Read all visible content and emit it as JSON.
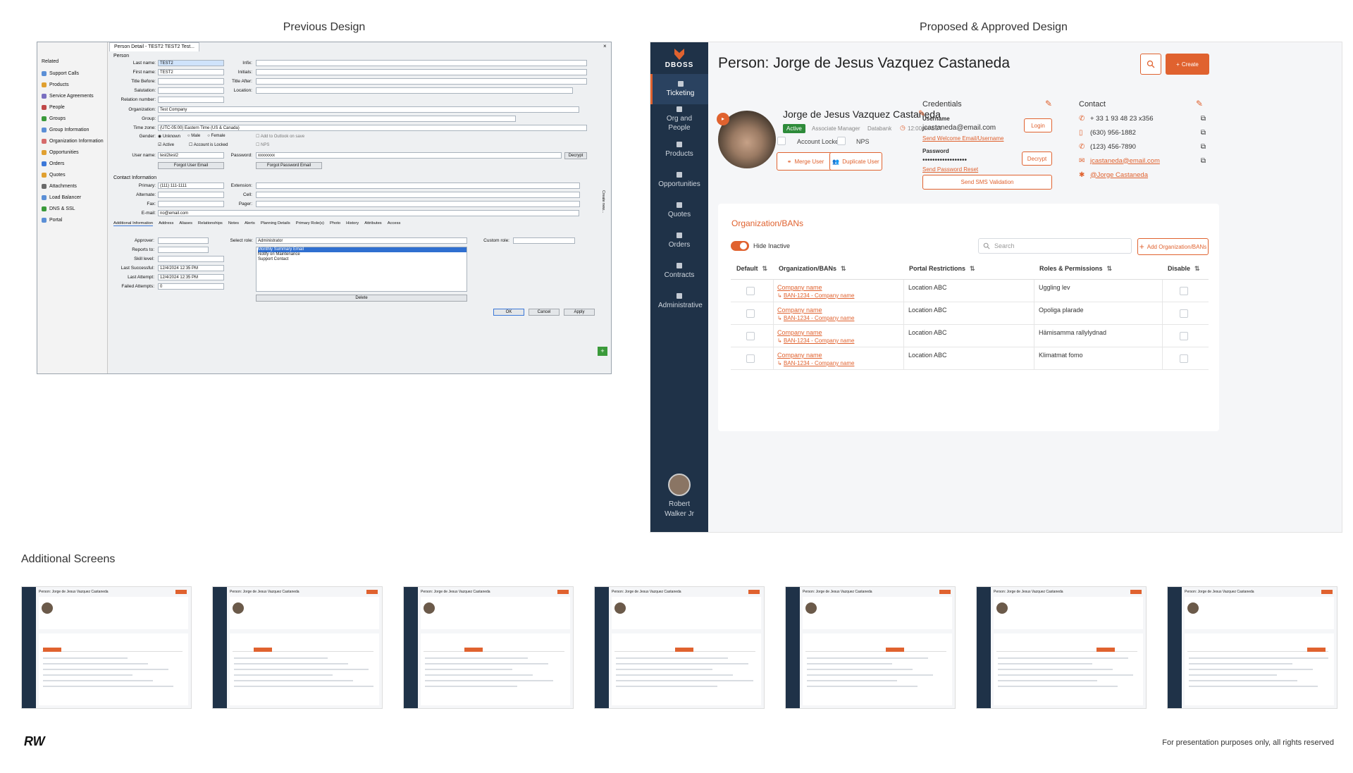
{
  "headings": {
    "previous": "Previous Design",
    "proposed": "Proposed & Approved Design",
    "additional": "Additional Screens",
    "footer_note": "For presentation purposes only, all rights reserved",
    "logo_mark": "RW"
  },
  "old": {
    "tab_title": "Person Detail - TEST2 TEST2   Test...",
    "related_label": "Related",
    "sidebar": [
      "Support Calls",
      "Products",
      "Service Agreements",
      "People",
      "Groups",
      "Group Information",
      "Organization Information",
      "Opportunities",
      "Orders",
      "Quotes",
      "Attachments",
      "Load Balancer",
      "DNS & SSL",
      "Portal"
    ],
    "person_label": "Person",
    "labels": {
      "last_name": "Last name:",
      "first_name": "First name:",
      "title_before": "Title Before:",
      "salutation": "Salutation:",
      "relation_number": "Relation number:",
      "organization": "Organization:",
      "group": "Group:",
      "timezone": "Time zone:",
      "gender": "Gender:",
      "user_name": "User name:",
      "password": "Password:",
      "infix": "Infix:",
      "initials": "Initials:",
      "title_after": "Title After:",
      "location": "Location:"
    },
    "values": {
      "last_name": "TEST2",
      "first_name": "TEST2",
      "organization": "Test Company",
      "timezone": "(UTC-05:00) Eastern Time (US & Canada)",
      "user_name": "test2test2",
      "password": "xxxxxxxx"
    },
    "gender_options": [
      "Unknown",
      "Male",
      "Female"
    ],
    "checks": {
      "active": "Active",
      "locked": "Account is Locked",
      "outlook": "Add to Outlook on save",
      "nps": "NPS"
    },
    "buttons": {
      "forgot_user": "Forgot User Email",
      "forgot_pw": "Forgot Password Email",
      "decrypt": "Decrypt",
      "delete": "Delete",
      "ok": "OK",
      "cancel": "Cancel",
      "apply": "Apply"
    },
    "contact_label": "Contact Information",
    "contact_labels": {
      "primary": "Primary:",
      "alternate": "Alternate:",
      "fax": "Fax:",
      "email": "E-mail:",
      "extension": "Extension:",
      "cell": "Cell:",
      "pager": "Pager:"
    },
    "contact_values": {
      "primary": "(111) 111-1111",
      "email": "no@email.com"
    },
    "tabs": [
      "Additional Information",
      "Address",
      "Aliases",
      "Relationships",
      "Notes",
      "Alerts",
      "Planning Details",
      "Primary Role(s)",
      "Photo",
      "History",
      "Attributes",
      "Access"
    ],
    "addl_labels": {
      "approver": "Approver:",
      "reports_to": "Reports to:",
      "skill": "Skill level:",
      "last_success": "Last Successful:",
      "last_attempt": "Last Attempt:",
      "failed": "Failed Attempts:",
      "select_role": "Select role:",
      "custom_role": "Custom role:"
    },
    "addl_values": {
      "last_success": "12/4/2024 12:35 PM",
      "last_attempt": "12/4/2024 12:35 PM",
      "failed": "0",
      "role": "Administrator"
    },
    "role_list": [
      "Monthly Summary Email",
      "Notify on Maintenance",
      "Support Contact"
    ],
    "side_text": "Create new..."
  },
  "app": {
    "brand": "DBOSS",
    "nav": [
      {
        "label": "Ticketing",
        "icon": "ticket-icon"
      },
      {
        "label": "Org and People",
        "icon": "people-icon"
      },
      {
        "label": "Products",
        "icon": "box-icon"
      },
      {
        "label": "Opportunities",
        "icon": "star-icon"
      },
      {
        "label": "Quotes",
        "icon": "quote-icon"
      },
      {
        "label": "Orders",
        "icon": "cart-icon"
      },
      {
        "label": "Contracts",
        "icon": "contract-icon"
      },
      {
        "label": "Administrative",
        "icon": "admin-icon"
      }
    ],
    "user_first": "Robert",
    "user_last": "Walker Jr",
    "page_title": "Person: Jorge de Jesus Vazquez Castaneda",
    "create_label": "Create",
    "person": {
      "name": "Jorge de Jesus Vazquez Castaneda",
      "status": "Active",
      "role": "Associate Manager",
      "source": "Databank",
      "time": "12:00pm EST",
      "account_locked": "Account Locked",
      "nps": "NPS",
      "merge": "Merge User",
      "duplicate": "Duplicate User"
    },
    "credentials": {
      "title": "Credentials",
      "username_label": "Username",
      "username": "jcastaneda@email.com",
      "login": "Login",
      "send_welcome": "Send Welcome Email/Username",
      "password_label": "Password",
      "password": "••••••••••••••••••",
      "decrypt": "Decrypt",
      "send_reset": "Send Password Reset",
      "sms": "Send SMS Validation"
    },
    "contact": {
      "title": "Contact",
      "items": [
        "+ 33 1 93 48 23 x356",
        "(630) 956-1882",
        "(123) 456-7890",
        "jcastaneda@email.com",
        "@Jorge Castaneda"
      ]
    },
    "orgs": {
      "title": "Organization/BANs",
      "hide_inactive": "Hide Inactive",
      "search_placeholder": "Search",
      "add": "Add Organization/BANs",
      "columns": [
        "Default",
        "Organization/BANs",
        "Portal Restrictions",
        "Roles & Permissions",
        "Disable"
      ],
      "rows": [
        {
          "company": "Company name",
          "ban": "BAN-1234 - Company name",
          "portal": "Location ABC",
          "role": "Uggling lev"
        },
        {
          "company": "Company name",
          "ban": "BAN-1234 - Company name",
          "portal": "Location ABC",
          "role": "Opoliga plarade"
        },
        {
          "company": "Company name",
          "ban": "BAN-1234 - Company name",
          "portal": "Location ABC",
          "role": "Hämisamma rallylydnad"
        },
        {
          "company": "Company name",
          "ban": "BAN-1234 - Company name",
          "portal": "Location ABC",
          "role": "Klimatmat fomo"
        }
      ]
    }
  },
  "colors": {
    "accent": "#e0622f",
    "nav": "#1f3248",
    "active_badge": "#2e8b3a"
  }
}
